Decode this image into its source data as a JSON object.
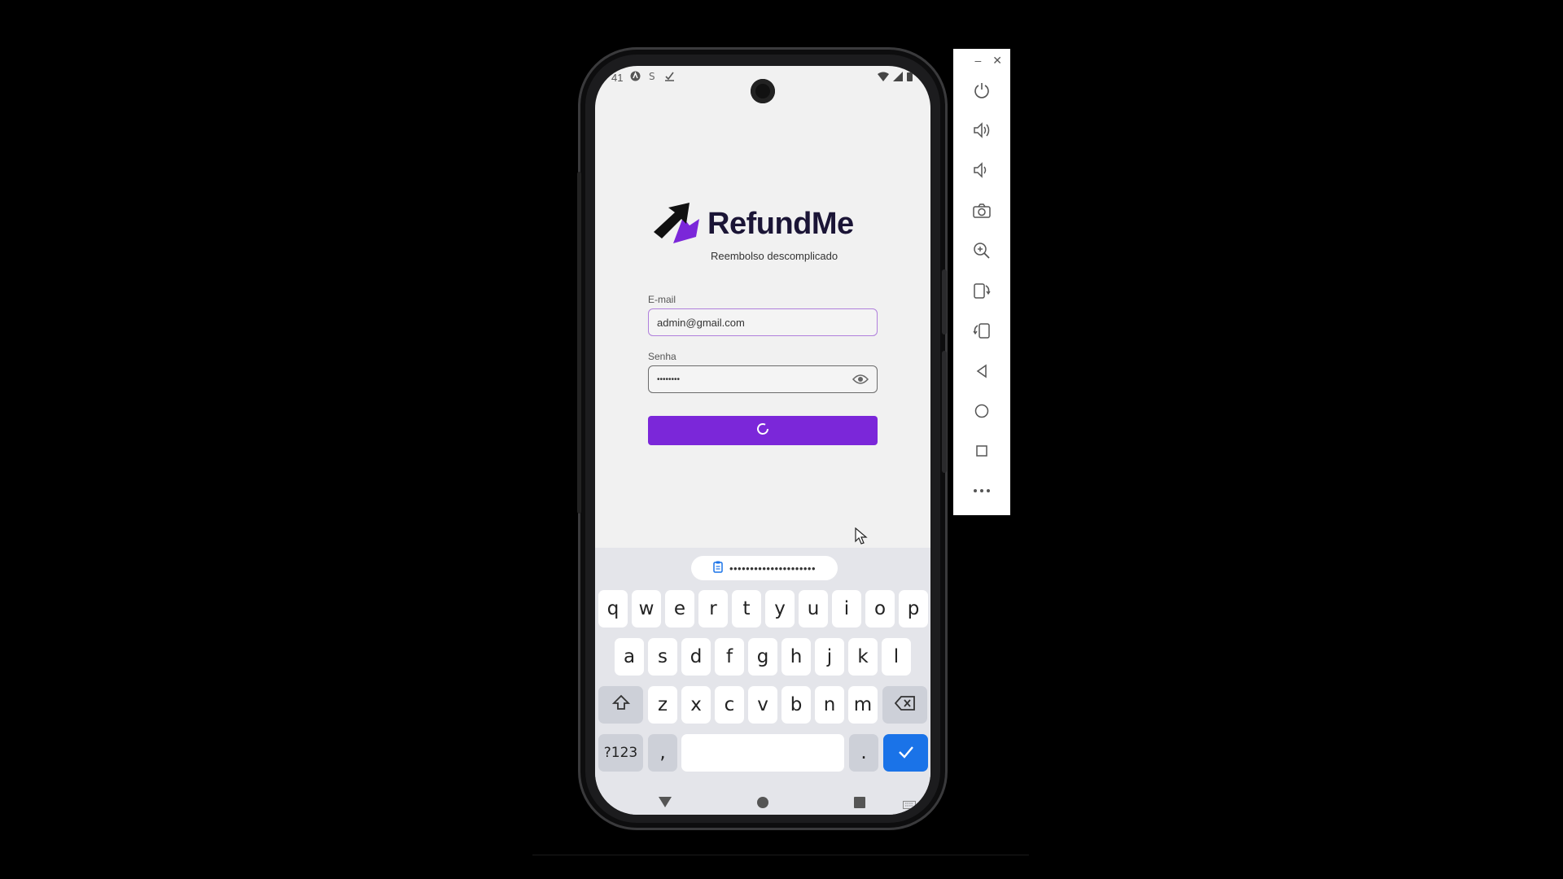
{
  "status_bar": {
    "time": "41",
    "left_icons": [
      "app-icon",
      "sync-icon",
      "check-icon"
    ],
    "right_icons": [
      "wifi-icon",
      "signal-icon",
      "battery-icon"
    ]
  },
  "app": {
    "name": "RefundMe",
    "tagline": "Reembolso descomplicado",
    "brand_color": "#7b27d9",
    "email_label": "E-mail",
    "email_value": "admin@gmail.com",
    "password_label": "Senha",
    "password_value": "••••••••",
    "login_button_state": "loading"
  },
  "keyboard": {
    "suggestion": "•••••••••••••••••••••",
    "row1": [
      "q",
      "w",
      "e",
      "r",
      "t",
      "y",
      "u",
      "i",
      "o",
      "p"
    ],
    "row2": [
      "a",
      "s",
      "d",
      "f",
      "g",
      "h",
      "j",
      "k",
      "l"
    ],
    "row3": [
      "z",
      "x",
      "c",
      "v",
      "b",
      "n",
      "m"
    ],
    "symbols_key": "?123",
    "comma_key": ",",
    "period_key": "."
  },
  "emulator_panel": {
    "window_buttons": [
      "minimize-icon",
      "close-icon"
    ],
    "minimize_label": "–",
    "close_label": "✕",
    "tools": [
      "power-icon",
      "volume-up-icon",
      "volume-down-icon",
      "camera-icon",
      "zoom-icon",
      "rotate-left-icon",
      "rotate-right-icon",
      "back-icon",
      "home-icon",
      "overview-icon",
      "more-icon"
    ]
  }
}
